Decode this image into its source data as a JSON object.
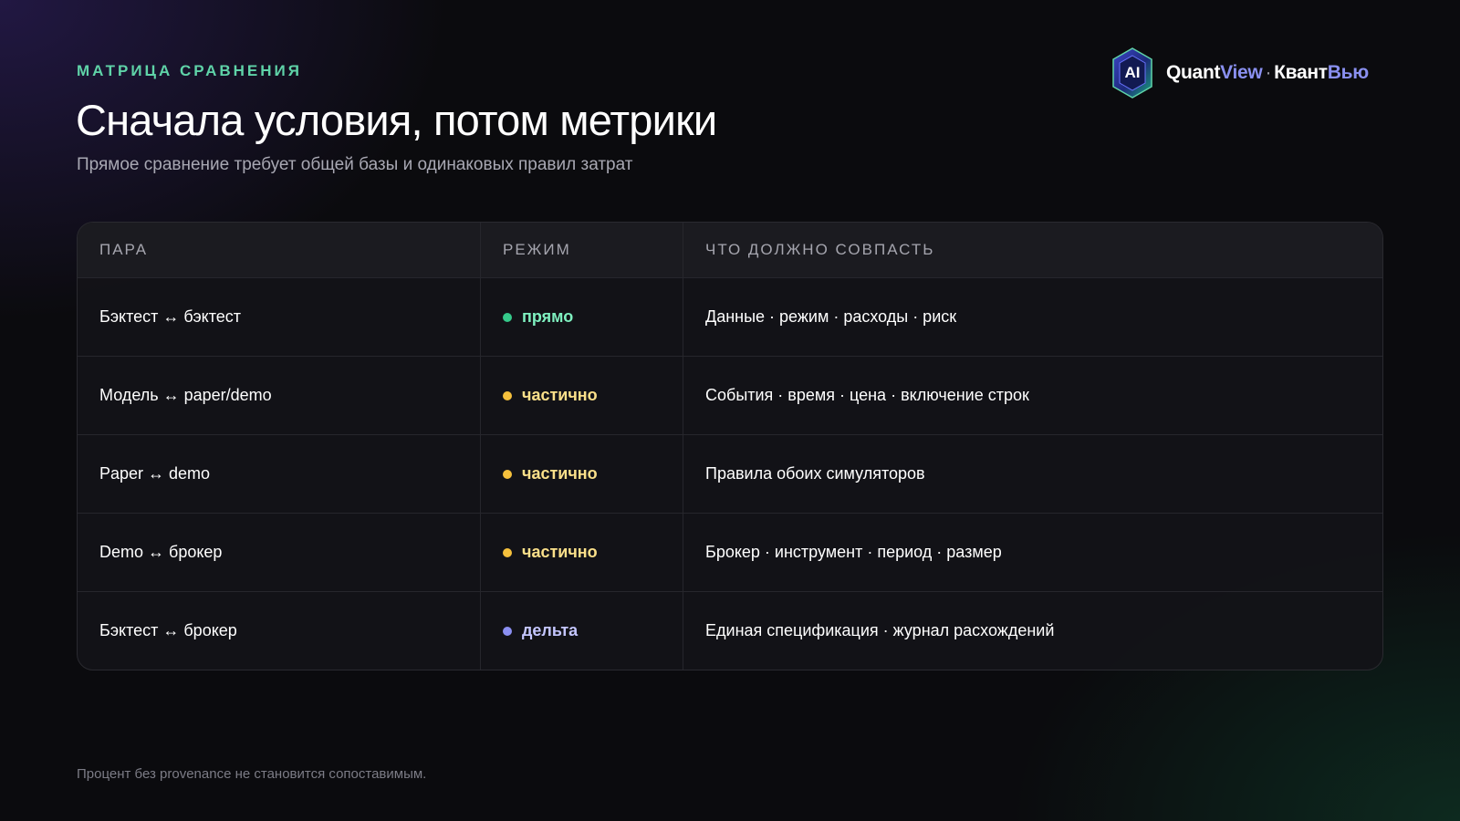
{
  "header": {
    "eyebrow": "МАТРИЦА СРАВНЕНИЯ",
    "title": "Сначала условия, потом метрики",
    "subtitle": "Прямое сравнение требует общей базы и одинаковых правил затрат"
  },
  "brand": {
    "logo_text": "AI",
    "name_white_1": "Quant",
    "name_accent_1": "View",
    "separator": "·",
    "name_white_2": "Квант",
    "name_accent_2": "Вью",
    "accent_color": "#8a90f0"
  },
  "table": {
    "columns": [
      "ПАРА",
      "РЕЖИМ",
      "ЧТО ДОЛЖНО СОВПАСТЬ"
    ],
    "rows": [
      {
        "pair": "Бэктест ↔ бэктест",
        "mode": "прямо",
        "mode_color": "#35c98a",
        "mode_text_color": "#7ff0c0",
        "match": "Данные · режим · расходы · риск"
      },
      {
        "pair": "Модель ↔ paper/demo",
        "mode": "частично",
        "mode_color": "#f5c03c",
        "mode_text_color": "#fbe08a",
        "match": "События · время · цена · включение строк"
      },
      {
        "pair": "Paper ↔ demo",
        "mode": "частично",
        "mode_color": "#f5c03c",
        "mode_text_color": "#fbe08a",
        "match": "Правила обоих симуляторов"
      },
      {
        "pair": "Demo ↔ брокер",
        "mode": "частично",
        "mode_color": "#f5c03c",
        "mode_text_color": "#fbe08a",
        "match": "Брокер · инструмент · период · размер"
      },
      {
        "pair": "Бэктест ↔ брокер",
        "mode": "дельта",
        "mode_color": "#8b8ff2",
        "mode_text_color": "#c4c6ff",
        "match": "Единая спецификация · журнал расхождений"
      }
    ]
  },
  "footer": {
    "note": "Процент без provenance не становится сопоставимым."
  }
}
